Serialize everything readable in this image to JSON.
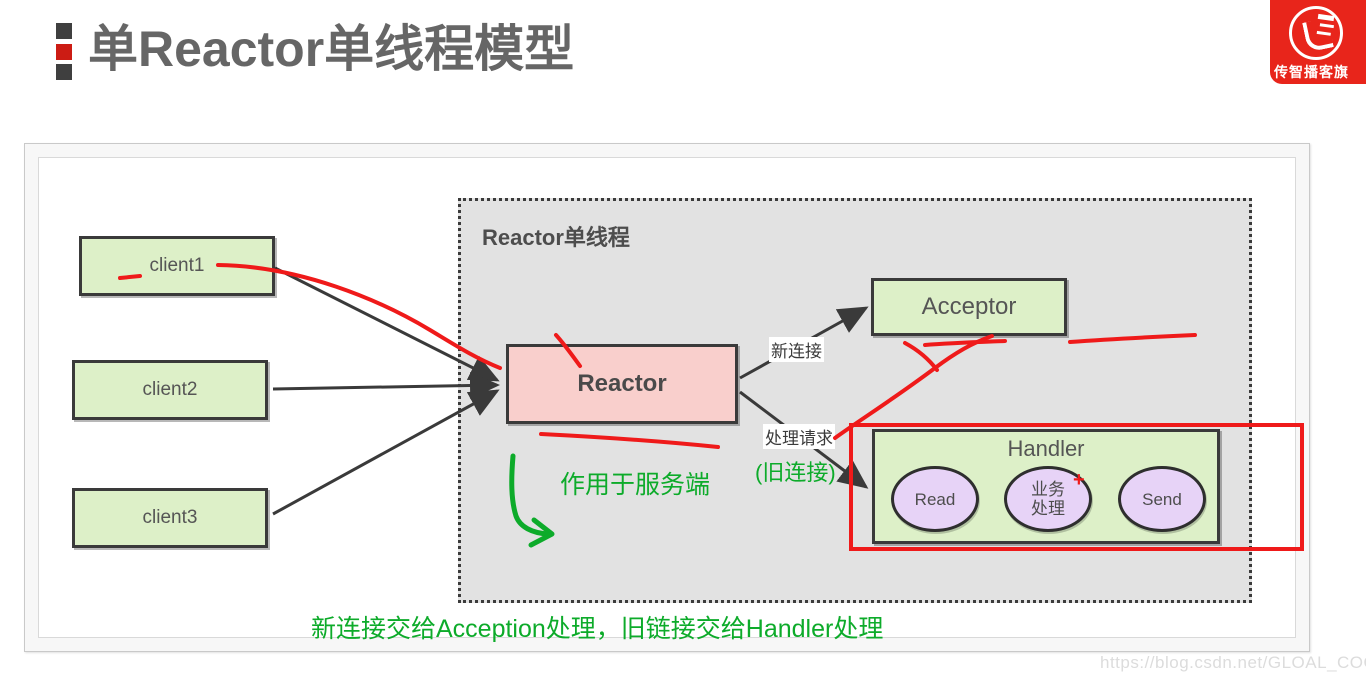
{
  "header": {
    "title": "单Reactor单线程模型",
    "bullet_colors": [
      "#3f3f3f",
      "#cc1c14",
      "#3f3f3f"
    ],
    "brand": {
      "text": "传智播客旗",
      "badge_color": "#e8251b",
      "logo_icon": "horse-head-icon"
    }
  },
  "diagram": {
    "container_label": "Reactor单线程",
    "clients": [
      {
        "label": "client1"
      },
      {
        "label": "client2"
      },
      {
        "label": "client3"
      }
    ],
    "reactor": {
      "label": "Reactor",
      "fill": "#f9cfcc"
    },
    "acceptor": {
      "label": "Acceptor",
      "fill": "#ddf0c8"
    },
    "handler": {
      "title": "Handler",
      "fill": "#ddf0c8",
      "nodes": [
        {
          "label": "Read"
        },
        {
          "label": "业务\n处理",
          "line1": "业务",
          "line2": "处理"
        },
        {
          "label": "Send"
        }
      ]
    },
    "edge_labels": {
      "new_connection": "新连接",
      "handle_request": "处理请求"
    }
  },
  "annotations": {
    "old_connection": "(旧连接)",
    "server_side": "作用于服务端",
    "caption": "新连接交给Acception处理，旧链接交给Handler处理",
    "plus": "+",
    "green_color": "#0dab2a",
    "red_color": "#ef1a1a"
  },
  "watermark": "https://blog.csdn.net/GLOAL_COOK"
}
